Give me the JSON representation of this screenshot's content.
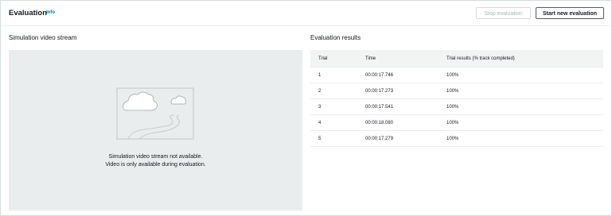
{
  "header": {
    "title": "Evaluation",
    "info": "Info",
    "stop_button": "Stop evaluation",
    "start_button": "Start new evaluation"
  },
  "video": {
    "title": "Simulation video stream",
    "message_line1": "Simulation video stream not available.",
    "message_line2": "Video is only available during evaluation.",
    "placeholder_icon": "image-placeholder-icon"
  },
  "results": {
    "title": "Evaluation results",
    "columns": [
      "Trial",
      "Time",
      "Trial results (% track completed)"
    ],
    "rows": [
      {
        "trial": "1",
        "time": "00:00:17.746",
        "result": "100%"
      },
      {
        "trial": "2",
        "time": "00:00:17.273",
        "result": "100%"
      },
      {
        "trial": "3",
        "time": "00:00:17.541",
        "result": "100%"
      },
      {
        "trial": "4",
        "time": "00:00:18.080",
        "result": "100%"
      },
      {
        "trial": "5",
        "time": "00:00:17.279",
        "result": "100%"
      }
    ]
  },
  "colors": {
    "link": "#0073bb",
    "disabled_text": "#aab7b8",
    "placeholder_bg": "#eaeded"
  }
}
